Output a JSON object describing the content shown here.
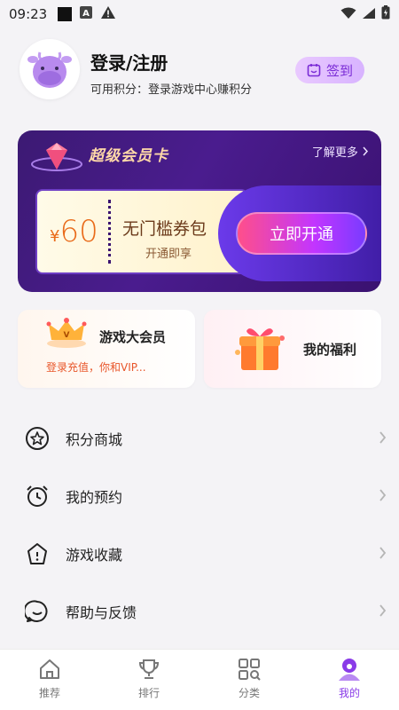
{
  "status_bar": {
    "time": "09:23",
    "icons": [
      "black-square-icon",
      "a-box-icon",
      "warning-icon",
      "wifi-icon",
      "signal-icon",
      "battery-icon"
    ]
  },
  "header": {
    "title": "登录/注册",
    "points_label": "可用积分：",
    "points_hint": "登录游戏中心赚积分",
    "checkin_label": "签到"
  },
  "vip_card": {
    "title": "超级会员卡",
    "more_label": "了解更多",
    "price_symbol": "¥",
    "price": "60",
    "coupon_name": "无门槛券包",
    "coupon_sub": "开通即享",
    "open_button": "立即开通"
  },
  "features": [
    {
      "title": "游戏大会员",
      "subtitle": "登录充值，你和VIP..."
    },
    {
      "title": "我的福利"
    }
  ],
  "menu": [
    {
      "label": "积分商城",
      "icon": "star-circle-icon"
    },
    {
      "label": "我的预约",
      "icon": "alarm-clock-icon"
    },
    {
      "label": "游戏收藏",
      "icon": "bookmark-star-icon"
    },
    {
      "label": "帮助与反馈",
      "icon": "smile-chat-icon"
    }
  ],
  "bottom_nav": [
    {
      "label": "推荐",
      "icon": "home-icon"
    },
    {
      "label": "排行",
      "icon": "trophy-icon"
    },
    {
      "label": "分类",
      "icon": "grid-icon"
    },
    {
      "label": "我的",
      "icon": "profile-icon",
      "active": true
    }
  ],
  "colors": {
    "accent": "#8a3be8",
    "vip_bg": "#3c1a73",
    "price": "#e96b1a",
    "open_button": "#c235ff"
  }
}
